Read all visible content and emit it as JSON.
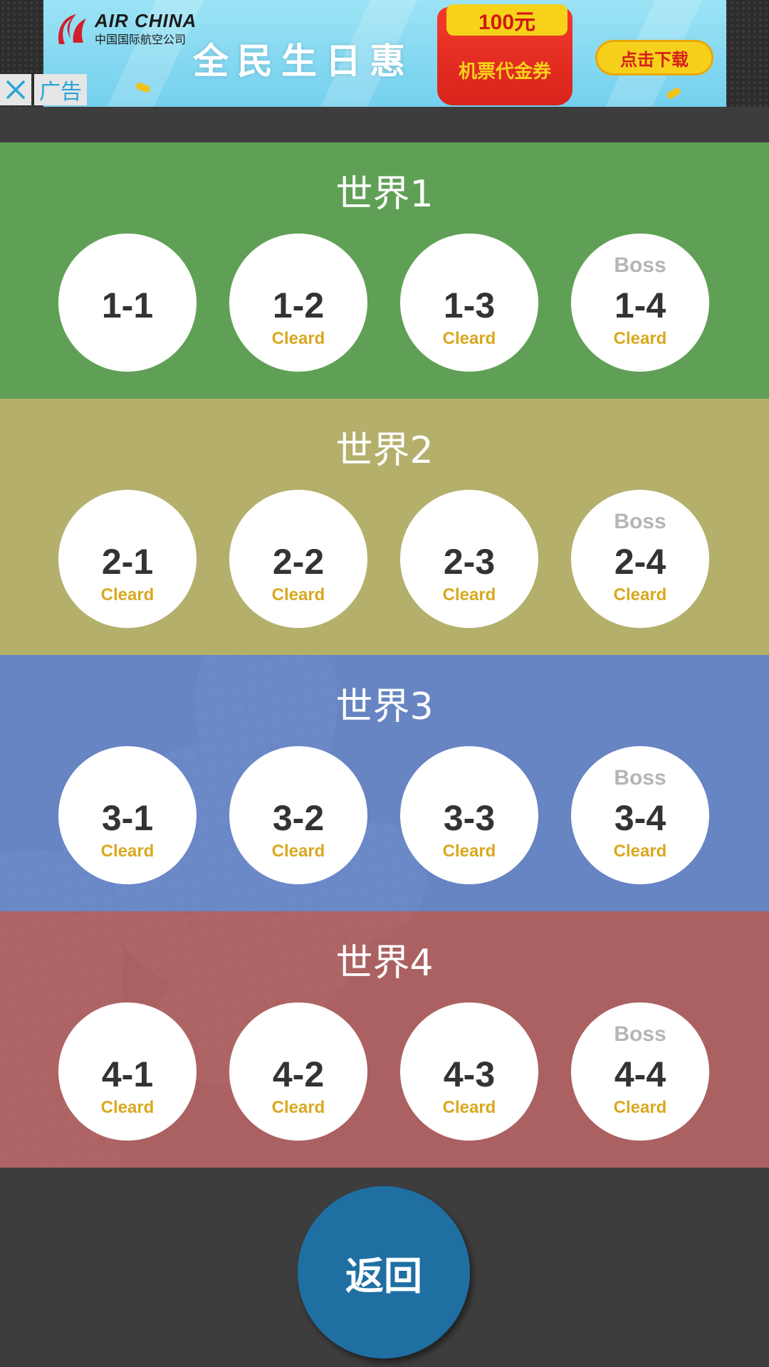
{
  "ad": {
    "brand": "AIR CHINA",
    "brand_sub": "中国国际航空公司",
    "slogan": "全民生日惠",
    "voucher_amount": "100元",
    "voucher_text": "机票代金券",
    "cta": "点击下载",
    "close_icon": "close-icon",
    "label": "广告",
    "colors": {
      "banner": "#7fd6f0",
      "envelope": "#e52a20",
      "cta": "#f7d01c"
    }
  },
  "worlds": [
    {
      "title": "世界1",
      "color": "#60a056",
      "levels": [
        {
          "number": "1-1",
          "boss": "",
          "status": ""
        },
        {
          "number": "1-2",
          "boss": "",
          "status": "Cleard"
        },
        {
          "number": "1-3",
          "boss": "",
          "status": "Cleard"
        },
        {
          "number": "1-4",
          "boss": "Boss",
          "status": "Cleard"
        }
      ]
    },
    {
      "title": "世界2",
      "color": "#b4b06c",
      "levels": [
        {
          "number": "2-1",
          "boss": "",
          "status": "Cleard"
        },
        {
          "number": "2-2",
          "boss": "",
          "status": "Cleard"
        },
        {
          "number": "2-3",
          "boss": "",
          "status": "Cleard"
        },
        {
          "number": "2-4",
          "boss": "Boss",
          "status": "Cleard"
        }
      ]
    },
    {
      "title": "世界3",
      "color": "#6c8cd2",
      "levels": [
        {
          "number": "3-1",
          "boss": "",
          "status": "Cleard"
        },
        {
          "number": "3-2",
          "boss": "",
          "status": "Cleard"
        },
        {
          "number": "3-3",
          "boss": "",
          "status": "Cleard"
        },
        {
          "number": "3-4",
          "boss": "Boss",
          "status": "Cleard"
        }
      ]
    },
    {
      "title": "世界4",
      "color": "#b46464",
      "levels": [
        {
          "number": "4-1",
          "boss": "",
          "status": "Cleard"
        },
        {
          "number": "4-2",
          "boss": "",
          "status": "Cleard"
        },
        {
          "number": "4-3",
          "boss": "",
          "status": "Cleard"
        },
        {
          "number": "4-4",
          "boss": "Boss",
          "status": "Cleard"
        }
      ]
    }
  ],
  "back_button": {
    "label": "返回",
    "color": "#1f6fa3"
  },
  "background_color": "#3d3d3d"
}
